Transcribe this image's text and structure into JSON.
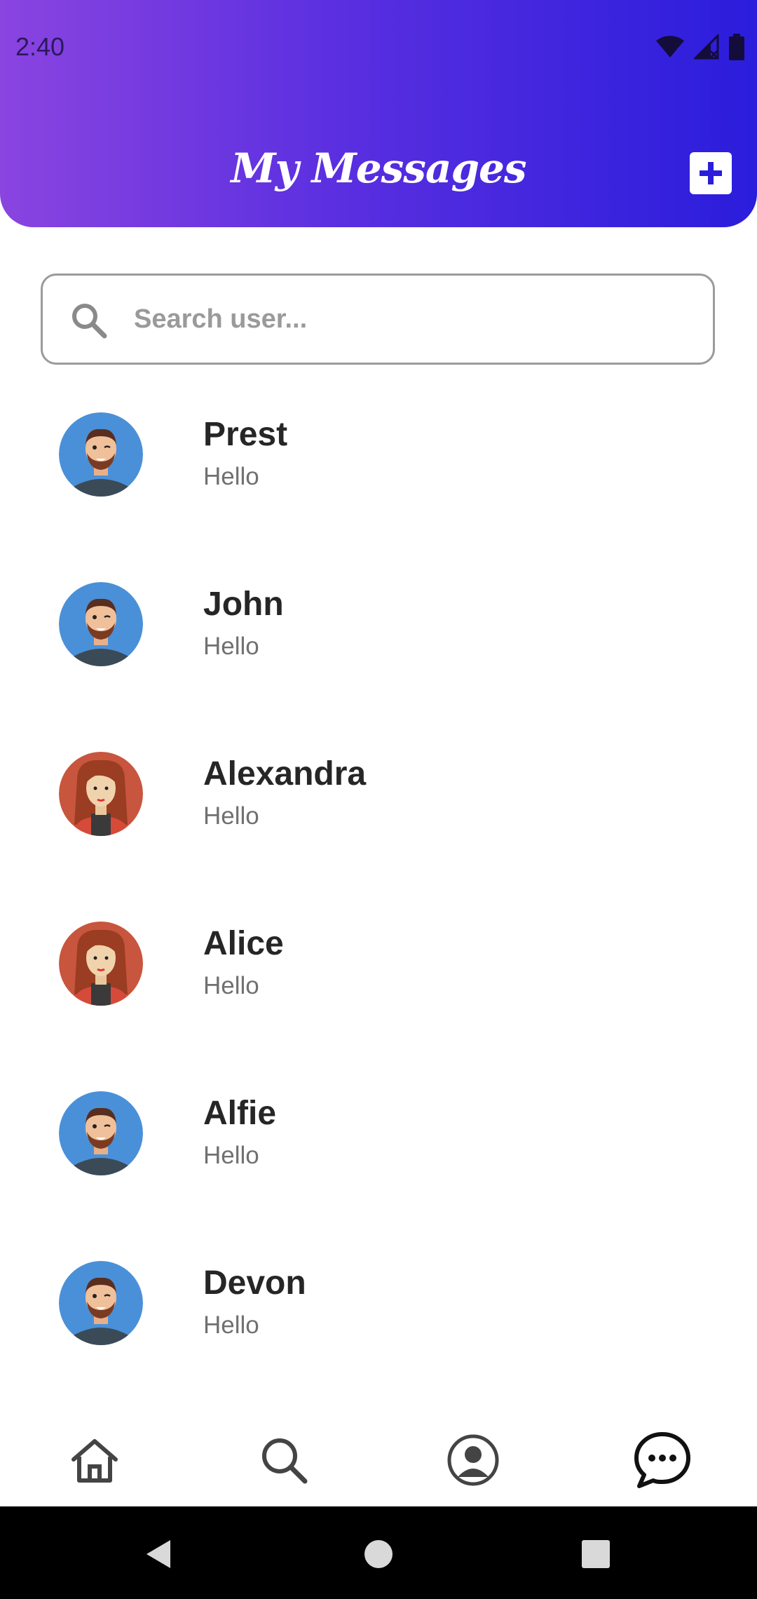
{
  "status_bar": {
    "time": "2:40"
  },
  "header": {
    "title": "My Messages"
  },
  "search": {
    "placeholder": "Search user..."
  },
  "contacts": [
    {
      "name": "Prest",
      "message": "Hello",
      "avatar": "male"
    },
    {
      "name": "John",
      "message": "Hello",
      "avatar": "male"
    },
    {
      "name": "Alexandra",
      "message": "Hello",
      "avatar": "female"
    },
    {
      "name": "Alice",
      "message": "Hello",
      "avatar": "female"
    },
    {
      "name": "Alfie",
      "message": "Hello",
      "avatar": "male"
    },
    {
      "name": "Devon",
      "message": "Hello",
      "avatar": "male"
    }
  ],
  "bottom_nav": [
    "home-icon",
    "search-icon",
    "profile-icon",
    "chat-icon"
  ],
  "colors": {
    "gradient_start": "#8a44e0",
    "gradient_end": "#2a1ddc",
    "male_avatar_bg": "#4a90d9",
    "female_avatar_bg": "#c8553d"
  }
}
